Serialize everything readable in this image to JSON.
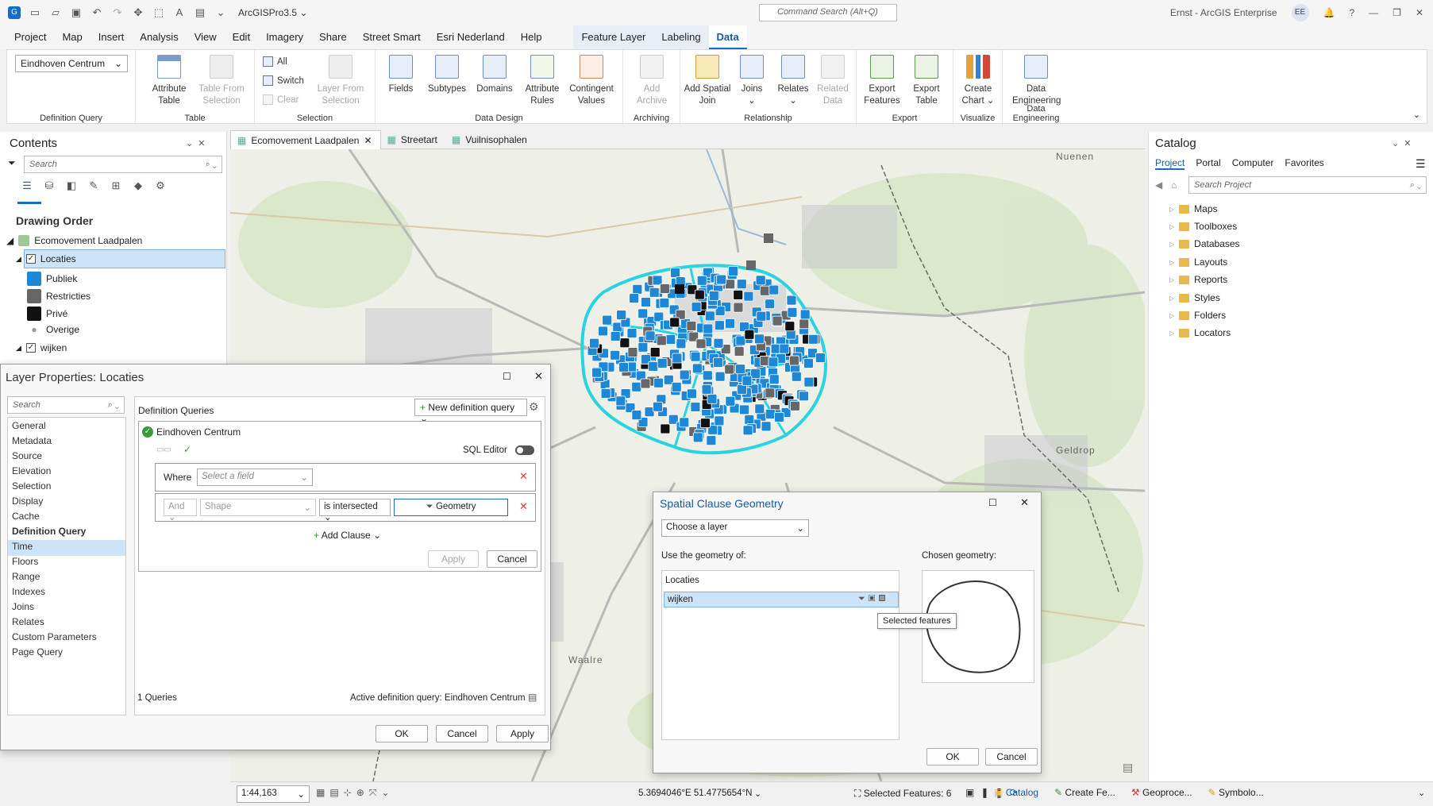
{
  "app": {
    "title": "ArcGISPro3.5 ⌄",
    "command_search_placeholder": "Command Search (Alt+Q)",
    "user": "Ernst - ArcGIS Enterprise",
    "user_initials": "EE"
  },
  "menu": [
    "Project",
    "Map",
    "Insert",
    "Analysis",
    "View",
    "Edit",
    "Imagery",
    "Share",
    "Street Smart",
    "Esri Nederland",
    "Help"
  ],
  "context_tabs": [
    "Feature Layer",
    "Labeling",
    "Data"
  ],
  "ribbon": {
    "defq_value": "Eindhoven Centrum",
    "defq_group": "Definition Query",
    "table_group": "Table",
    "attribute_table": "Attribute Table",
    "table_from_selection": "Table From Selection",
    "selection_group": "Selection",
    "sel_all": "All",
    "sel_switch": "Switch",
    "sel_clear": "Clear",
    "layer_from_selection": "Layer From Selection",
    "data_design_group": "Data Design",
    "fields": "Fields",
    "subtypes": "Subtypes",
    "domains": "Domains",
    "attribute_rules": "Attribute Rules",
    "contingent_values": "Contingent Values",
    "archiving_group": "Archiving",
    "add_archive": "Add Archive",
    "relationship_group": "Relationship",
    "add_spatial_join": "Add Spatial Join",
    "joins": "Joins",
    "relates": "Relates",
    "related_data": "Related Data",
    "export_group": "Export",
    "export_features": "Export Features",
    "export_table": "Export Table",
    "visualize_group": "Visualize",
    "create_chart": "Create Chart",
    "data_eng_group": "Data Engineering",
    "data_engineering": "Data Engineering"
  },
  "contents": {
    "title": "Contents",
    "search_placeholder": "Search",
    "drawing_order": "Drawing Order",
    "map_name": "Ecomovement Laadpalen",
    "layer": "Locaties",
    "classes": [
      "Publiek",
      "Restricties",
      "Privé",
      "Overige"
    ],
    "layer2": "wijken"
  },
  "map_tabs": [
    "Ecomovement Laadpalen",
    "Streetart",
    "Vuilnisophalen"
  ],
  "map_labels": {
    "nuenen": "Nuenen",
    "geldrop": "Geldrop",
    "waalre": "Waalre"
  },
  "catalog": {
    "title": "Catalog",
    "tabs": [
      "Project",
      "Portal",
      "Computer",
      "Favorites"
    ],
    "search_placeholder": "Search Project",
    "items": [
      "Maps",
      "Toolboxes",
      "Databases",
      "Layouts",
      "Reports",
      "Styles",
      "Folders",
      "Locators"
    ]
  },
  "layer_props": {
    "title": "Layer Properties: Locaties",
    "search_placeholder": "Search",
    "nav": [
      "General",
      "Metadata",
      "Source",
      "Elevation",
      "Selection",
      "Display",
      "Cache",
      "Definition Query",
      "Time",
      "Floors",
      "Range",
      "Indexes",
      "Joins",
      "Relates",
      "Custom Parameters",
      "Page Query"
    ],
    "section": "Definition Queries",
    "new_query": "New definition query",
    "query_name": "Eindhoven Centrum",
    "sql_editor": "SQL Editor",
    "where": "Where",
    "select_field": "Select a field",
    "and": "And",
    "shape": "Shape",
    "operator": "is intersected",
    "geometry": "Geometry",
    "add_clause": "Add Clause",
    "apply_inner": "Apply",
    "cancel_inner": "Cancel",
    "query_count": "1 Queries",
    "active_query": "Active definition query: Eindhoven Centrum",
    "ok": "OK",
    "cancel": "Cancel",
    "apply": "Apply"
  },
  "spatial": {
    "title": "Spatial Clause Geometry",
    "choose_layer": "Choose a layer",
    "use_geometry": "Use the geometry of:",
    "chosen": "Chosen geometry:",
    "list": [
      "Locaties",
      "wijken"
    ],
    "tooltip": "Selected features",
    "ok": "OK",
    "cancel": "Cancel"
  },
  "status": {
    "scale": "1:44,163",
    "coords": "5.3694046°E 51.4775654°N",
    "selected": "Selected Features: 6"
  },
  "bottom_tabs": [
    "Catalog",
    "Create Fe...",
    "Geoproce...",
    "Symbolo..."
  ],
  "colors": {
    "accent": "#1a6bc4",
    "cyan": "#2ad3e0",
    "point": "#1e88d6"
  }
}
